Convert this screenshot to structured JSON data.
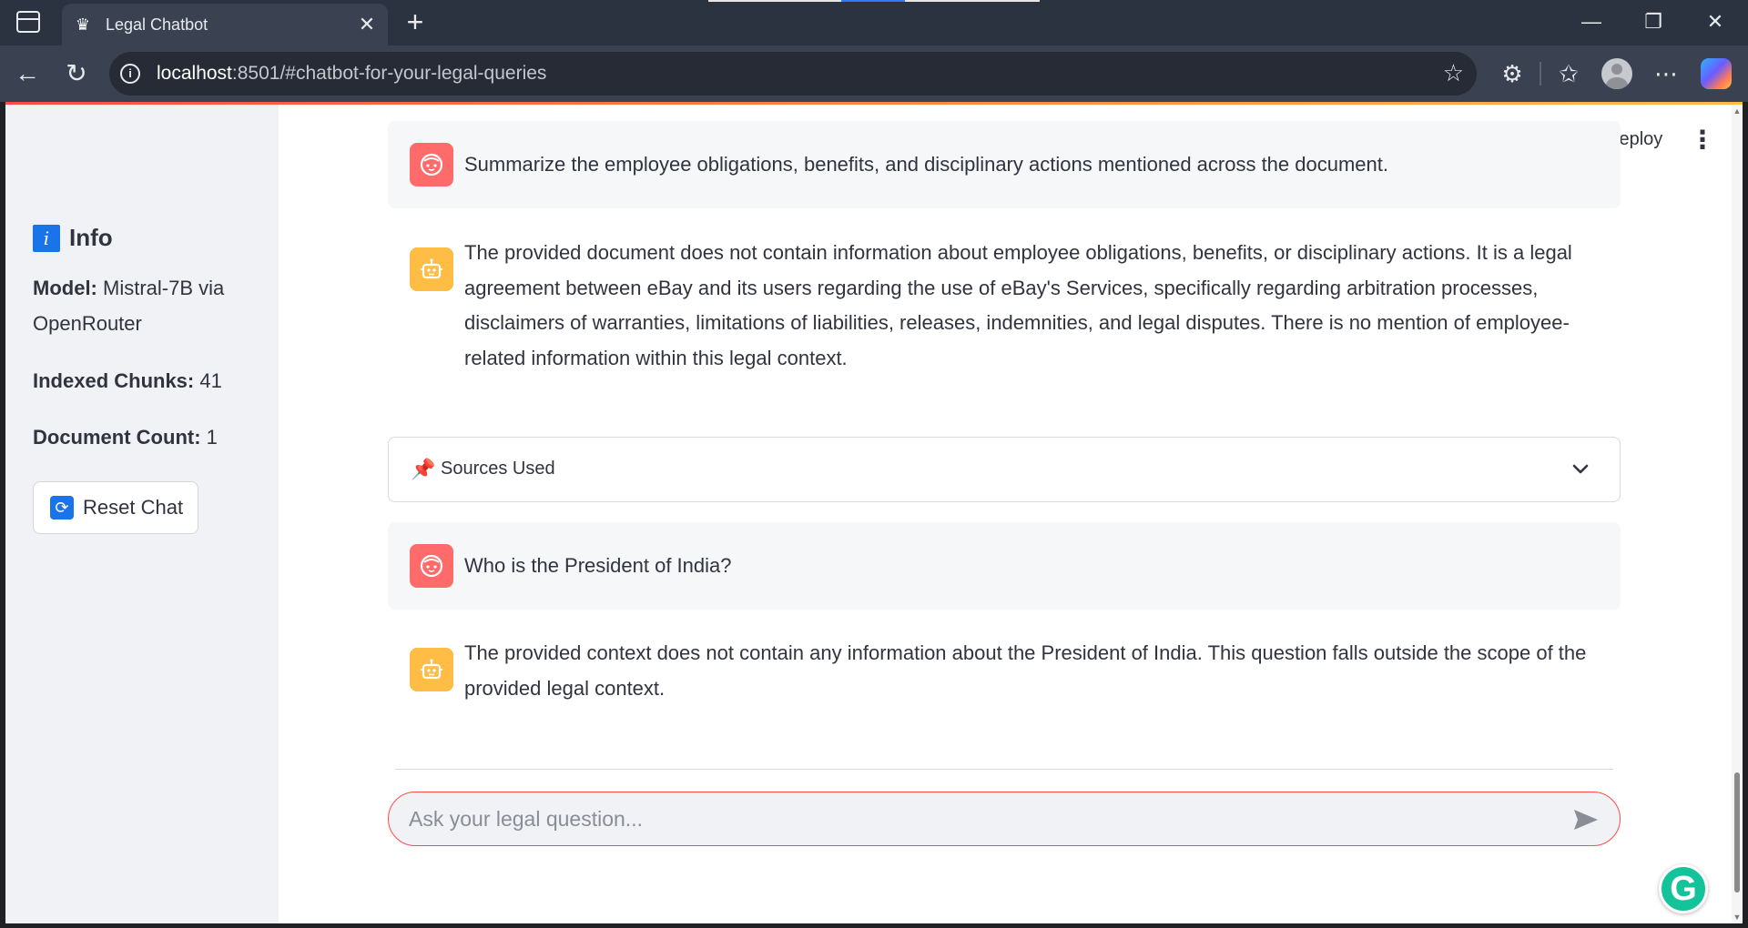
{
  "browser": {
    "tab_title": "Legal Chatbot",
    "url_host": "localhost",
    "url_rest": ":8501/#chatbot-for-your-legal-queries"
  },
  "app": {
    "deploy_label": "Deploy"
  },
  "sidebar": {
    "title": "Info",
    "model_label": "Model:",
    "model_value": "Mistral-7B via OpenRouter",
    "chunks_label": "Indexed Chunks:",
    "chunks_value": "41",
    "docs_label": "Document Count:",
    "docs_value": "1",
    "reset_label": "Reset Chat"
  },
  "chat": {
    "messages": [
      {
        "role": "user",
        "text": "Summarize the employee obligations, benefits, and disciplinary actions mentioned across the document."
      },
      {
        "role": "assistant",
        "text": "The provided document does not contain information about employee obligations, benefits, or disciplinary actions. It is a legal agreement between eBay and its users regarding the use of eBay's Services, specifically regarding arbitration processes, disclaimers of warranties, limitations of liabilities, releases, indemnities, and legal disputes. There is no mention of employee-related information within this legal context."
      },
      {
        "role": "user",
        "text": "Who is the President of India?"
      },
      {
        "role": "assistant",
        "text": "The provided context does not contain any information about the President of India. This question falls outside the scope of the provided legal context."
      }
    ],
    "sources_label": "Sources Used",
    "input_placeholder": "Ask your legal question..."
  },
  "colors": {
    "accent": "#ff4b4b",
    "user_avatar": "#ff6b6b",
    "bot_avatar": "#ffbd45",
    "sidebar_bg": "#f0f2f6"
  },
  "icons": {
    "tab_favicon": "crown-icon",
    "info": "info-icon",
    "reset": "refresh-icon",
    "sources": "pushpin-icon",
    "send": "send-icon",
    "grammarly": "grammarly-icon"
  }
}
